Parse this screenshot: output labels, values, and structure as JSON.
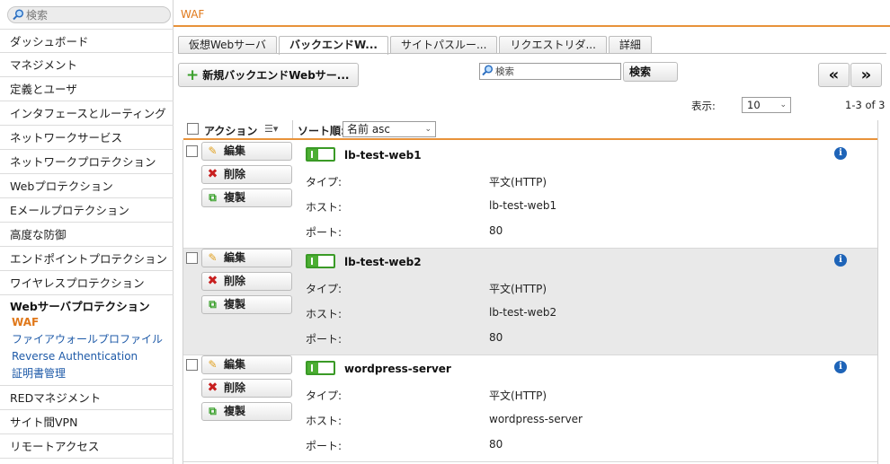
{
  "sidebar": {
    "search_placeholder": "検索",
    "items_top": [
      "ダッシュボード",
      "マネジメント",
      "定義とユーザ",
      "インタフェースとルーティング",
      "ネットワークサービス",
      "ネットワークプロテクション",
      "Webプロテクション",
      "Eメールプロテクション",
      "高度な防御",
      "エンドポイントプロテクション",
      "ワイヤレスプロテクション"
    ],
    "group": {
      "title": "Webサーバプロテクション",
      "subitems": [
        "WAF",
        "ファイアウォールプロファイル",
        "Reverse Authentication",
        "証明書管理"
      ],
      "active": "WAF"
    },
    "items_bottom": [
      "REDマネジメント",
      "サイト間VPN",
      "リモートアクセス"
    ]
  },
  "header": {
    "title": "WAF"
  },
  "tabs": [
    {
      "label": "仮想Webサーバ",
      "active": false
    },
    {
      "label": "バックエンドW...",
      "active": true
    },
    {
      "label": "サイトパスルー...",
      "active": false
    },
    {
      "label": "リクエストリダ...",
      "active": false
    },
    {
      "label": "詳細",
      "active": false
    }
  ],
  "toolbar": {
    "new_button": "新規バックエンドWebサー...",
    "search_placeholder": "検索",
    "search_button": "検索",
    "prev": "«",
    "next": "»",
    "display_label": "表示:",
    "per_page": "10",
    "range": "1-3 of 3"
  },
  "list_header": {
    "action_label": "アクション",
    "sort_label": "ソート順:",
    "sort_value": "名前 asc"
  },
  "actions": {
    "edit": "編集",
    "delete": "削除",
    "copy": "複製"
  },
  "labels": {
    "type": "タイプ:",
    "host": "ホスト:",
    "port": "ポート:"
  },
  "rows": [
    {
      "name": "lb-test-web1",
      "type": "平文(HTTP)",
      "host": "lb-test-web1",
      "port": "80",
      "enabled": true
    },
    {
      "name": "lb-test-web2",
      "type": "平文(HTTP)",
      "host": "lb-test-web2",
      "port": "80",
      "enabled": true
    },
    {
      "name": "wordpress-server",
      "type": "平文(HTTP)",
      "host": "wordpress-server",
      "port": "80",
      "enabled": true
    }
  ],
  "colors": {
    "accent": "#e8923a",
    "toggle_on": "#4cae33",
    "link": "#1e5aa8",
    "info": "#1e64b8"
  },
  "icons": {
    "search": "magnifier-icon",
    "info": "info-icon",
    "edit": "pencil-icon",
    "delete": "x-icon",
    "copy": "copy-icon",
    "add": "plus-icon"
  }
}
